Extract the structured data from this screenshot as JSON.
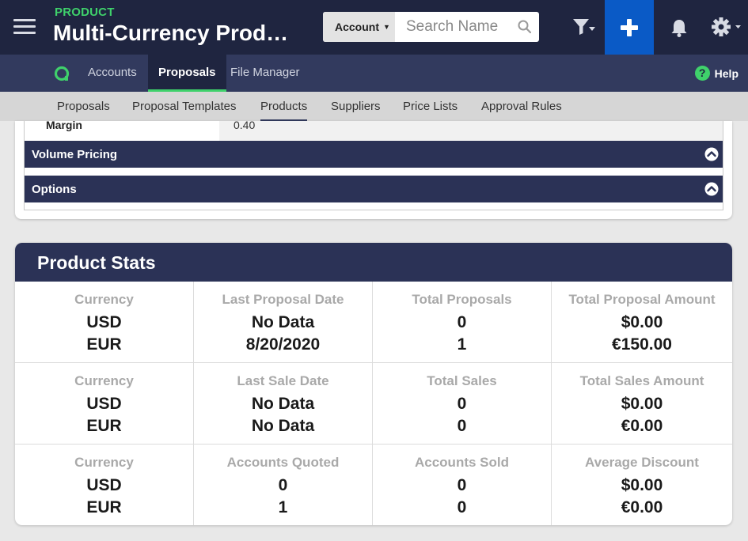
{
  "header": {
    "kicker": "PRODUCT",
    "title": "Multi-Currency Prod…",
    "search": {
      "scope": "Account",
      "placeholder": "Search Name"
    }
  },
  "tabs": [
    {
      "label": "Accounts"
    },
    {
      "label": "Proposals",
      "active": true
    },
    {
      "label": "File Manager"
    }
  ],
  "help_label": "Help",
  "subtabs": [
    {
      "label": "Proposals"
    },
    {
      "label": "Proposal Templates"
    },
    {
      "label": "Products",
      "active": true
    },
    {
      "label": "Suppliers"
    },
    {
      "label": "Price Lists"
    },
    {
      "label": "Approval Rules"
    }
  ],
  "upper": {
    "margin_label": "Margin",
    "margin_value": "0.40",
    "sections": [
      "Volume Pricing",
      "Options"
    ]
  },
  "stats": {
    "title": "Product Stats",
    "rows": [
      [
        {
          "header": "Currency",
          "v1": "USD",
          "v2": "EUR"
        },
        {
          "header": "Last Proposal Date",
          "v1": "No Data",
          "v2": "8/20/2020"
        },
        {
          "header": "Total Proposals",
          "v1": "0",
          "v2": "1"
        },
        {
          "header": "Total Proposal Amount",
          "v1": "$0.00",
          "v2": "€150.00"
        }
      ],
      [
        {
          "header": "Currency",
          "v1": "USD",
          "v2": "EUR"
        },
        {
          "header": "Last Sale Date",
          "v1": "No Data",
          "v2": "No Data"
        },
        {
          "header": "Total Sales",
          "v1": "0",
          "v2": "0"
        },
        {
          "header": "Total Sales Amount",
          "v1": "$0.00",
          "v2": "€0.00"
        }
      ],
      [
        {
          "header": "Currency",
          "v1": "USD",
          "v2": "EUR"
        },
        {
          "header": "Accounts Quoted",
          "v1": "0",
          "v2": "1"
        },
        {
          "header": "Accounts Sold",
          "v1": "0",
          "v2": "0"
        },
        {
          "header": "Average Discount",
          "v1": "$0.00",
          "v2": "€0.00"
        }
      ]
    ]
  },
  "colors": {
    "header_bg": "#1f2540",
    "nav_bg": "#323a5e",
    "accent_green": "#3fd16b",
    "add_button": "#0a5ac6"
  }
}
